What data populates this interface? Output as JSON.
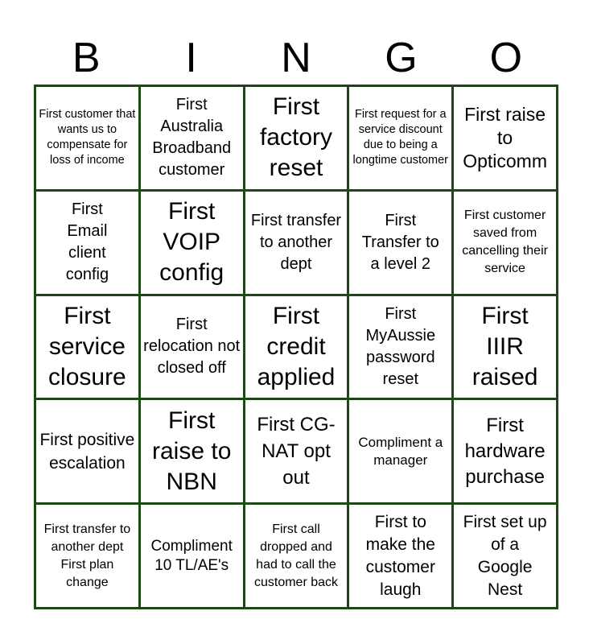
{
  "title_letters": [
    "B",
    "I",
    "N",
    "G",
    "O"
  ],
  "colors": {
    "grid_border": "#1b4a12",
    "cell_background": "#ffffff",
    "text": "#000000"
  },
  "cells": [
    [
      "First customer that wants us to compensate for loss of income",
      "First Australia Broadband customer",
      "First factory reset",
      "First request for a service discount due to being a longtime customer",
      "First raise to Opticomm"
    ],
    [
      "First Email client config",
      "First VOIP config",
      "First transfer to another dept",
      "First Transfer to a level 2",
      "First customer saved from cancelling their service"
    ],
    [
      "First service closure",
      "First relocation not closed off",
      "First credit applied",
      "First MyAussie password reset",
      "First IIIR raised"
    ],
    [
      "First positive escalation",
      "First raise to NBN",
      "First CG-NAT opt out",
      "Compliment a manager",
      "First hardware purchase"
    ],
    [
      "First transfer to another dept First plan change",
      "Compliment 10 TL/AE's",
      "First call dropped and had to call the customer back",
      "First to make the customer laugh",
      "First set up of a Google Nest"
    ]
  ]
}
